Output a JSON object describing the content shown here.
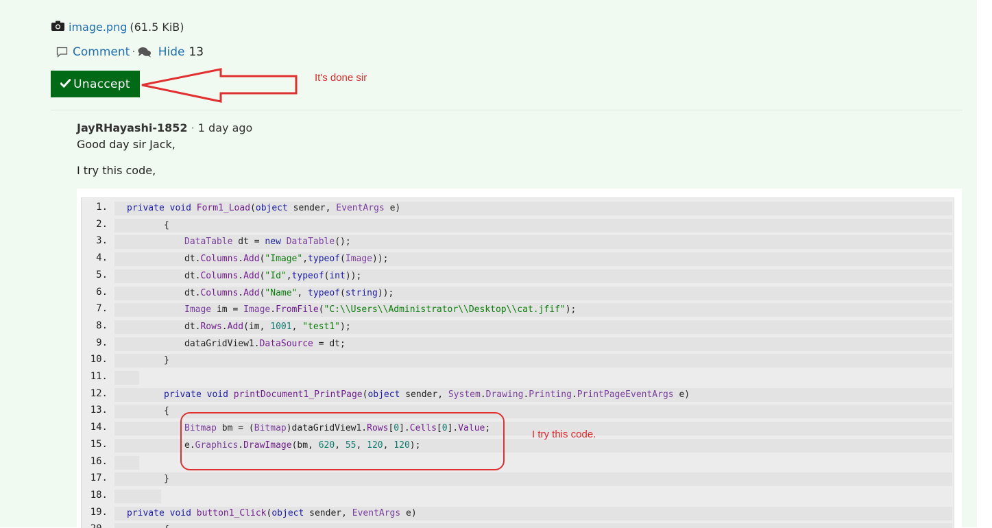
{
  "attachment": {
    "icon": "camera-icon",
    "filename": "image.png",
    "size": "(61.5 KiB)"
  },
  "actions": {
    "comment_label": "Comment",
    "hide_label": "Hide",
    "count": "13"
  },
  "accept_button": {
    "label": "Unaccept",
    "color": "#006a16"
  },
  "annotations": {
    "done": "It's done sir",
    "try_code": "I try this code."
  },
  "comment": {
    "author": "JayRHayashi-1852",
    "separator": "·",
    "time": "1 day ago",
    "greeting": "Good day sir Jack,",
    "intro": "I try this code,"
  },
  "code_lines": [
    {
      "num": "1.",
      "text": "private void Form1_Load(object sender, EventArgs e)"
    },
    {
      "num": "2.",
      "text": "{"
    },
    {
      "num": "3.",
      "text": "DataTable dt = new DataTable();"
    },
    {
      "num": "4.",
      "text": "dt.Columns.Add(\"Image\",typeof(Image));"
    },
    {
      "num": "5.",
      "text": "dt.Columns.Add(\"Id\",typeof(int));"
    },
    {
      "num": "6.",
      "text": "dt.Columns.Add(\"Name\", typeof(string));"
    },
    {
      "num": "7.",
      "text": "Image im = Image.FromFile(\"C:\\\\Users\\\\Administrator\\\\Desktop\\\\cat.jfif\");"
    },
    {
      "num": "8.",
      "text": "dt.Rows.Add(im, 1001, \"test1\");"
    },
    {
      "num": "9.",
      "text": "dataGridView1.DataSource = dt;"
    },
    {
      "num": "10.",
      "text": "}"
    },
    {
      "num": "11.",
      "text": ""
    },
    {
      "num": "12.",
      "text": "private void printDocument1_PrintPage(object sender, System.Drawing.Printing.PrintPageEventArgs e)"
    },
    {
      "num": "13.",
      "text": "{"
    },
    {
      "num": "14.",
      "text": "Bitmap bm = (Bitmap)dataGridView1.Rows[0].Cells[0].Value;"
    },
    {
      "num": "15.",
      "text": "e.Graphics.DrawImage(bm, 620, 55, 120, 120);"
    },
    {
      "num": "16.",
      "text": ""
    },
    {
      "num": "17.",
      "text": "}"
    },
    {
      "num": "18.",
      "text": ""
    },
    {
      "num": "19.",
      "text": "private void button1_Click(object sender, EventArgs e)"
    },
    {
      "num": "20.",
      "text": "{"
    }
  ],
  "colors": {
    "panel_background": "#f1faf1",
    "link": "#1f6fb2",
    "annotation_red": "#e02a2a",
    "keyword": "#1a1aa6",
    "type": "#7a3e9d",
    "string": "#0a7d0a",
    "number": "#0d7a6e"
  }
}
